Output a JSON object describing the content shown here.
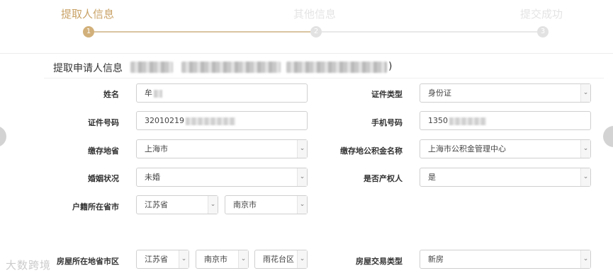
{
  "steps": [
    {
      "label": "提取人信息",
      "num": "1",
      "state": "active"
    },
    {
      "label": "其他信息",
      "num": "2",
      "state": "inactive"
    },
    {
      "label": "提交成功",
      "num": "3",
      "state": "inactive"
    }
  ],
  "section": {
    "title": "提取申请人信息",
    "close_paren": ")"
  },
  "form": {
    "name": {
      "label": "姓名",
      "value": "牟"
    },
    "id_type": {
      "label": "证件类型",
      "value": "身份证"
    },
    "id_number": {
      "label": "证件号码",
      "value": "32010219"
    },
    "phone": {
      "label": "手机号码",
      "value": "1350"
    },
    "deposit_province": {
      "label": "缴存地省",
      "value": "上海市"
    },
    "fund_center": {
      "label": "缴存地公积金名称",
      "value": "上海市公积金管理中心"
    },
    "marital": {
      "label": "婚姻状况",
      "value": "未婚"
    },
    "owner": {
      "label": "是否产权人",
      "value": "是"
    },
    "household": {
      "label": "户籍所在省市",
      "province": "江苏省",
      "city": "南京市"
    },
    "house_location": {
      "label": "房屋所在地省市区",
      "province": "江苏省",
      "city": "南京市",
      "district": "雨花台区"
    },
    "deal_type": {
      "label": "房屋交易类型",
      "value": "新房"
    }
  },
  "watermark": "大数跨境",
  "icons": {
    "dropdown": "chevron-down-icon"
  }
}
